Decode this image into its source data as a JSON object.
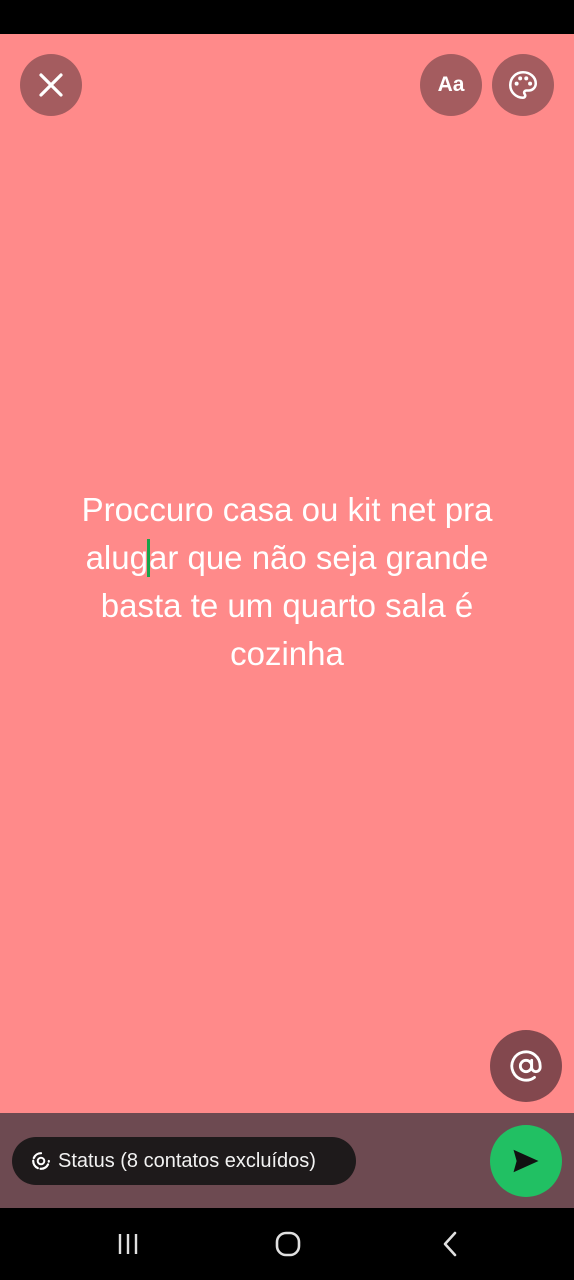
{
  "status_text": {
    "before_caret": "Proccuro casa ou kit net pra\nalug",
    "after_caret": "ar que não seja grande\nbasta te um quarto sala é\ncozinha"
  },
  "toolbar": {
    "font_label": "Aa"
  },
  "audience": {
    "label": "Status (8 contatos excluídos)"
  },
  "colors": {
    "canvas_background": "#ff8a8a",
    "bottom_bar": "#6d4a51",
    "send_button": "#21c063",
    "caret": "#1aa34a"
  },
  "icons": {
    "close": "close-icon",
    "palette": "palette-icon",
    "mention": "at-sign-icon",
    "send": "send-icon",
    "audience": "status-ring-icon"
  }
}
